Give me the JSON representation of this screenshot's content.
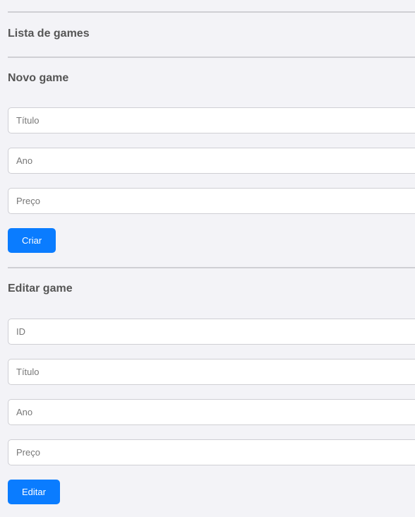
{
  "list_section": {
    "title": "Lista de games"
  },
  "create_section": {
    "title": "Novo game",
    "fields": {
      "titulo": {
        "value": "",
        "placeholder": "Título"
      },
      "ano": {
        "value": "",
        "placeholder": "Ano"
      },
      "preco": {
        "value": "",
        "placeholder": "Preço"
      }
    },
    "submit_label": "Criar"
  },
  "edit_section": {
    "title": "Editar game",
    "fields": {
      "id": {
        "value": "",
        "placeholder": "ID"
      },
      "titulo": {
        "value": "",
        "placeholder": "Título"
      },
      "ano": {
        "value": "",
        "placeholder": "Ano"
      },
      "preco": {
        "value": "",
        "placeholder": "Preço"
      }
    },
    "submit_label": "Editar"
  },
  "colors": {
    "background": "#f3f3f7",
    "accent": "#0a7cff",
    "divider": "#cfcfd4",
    "heading": "#555555"
  }
}
